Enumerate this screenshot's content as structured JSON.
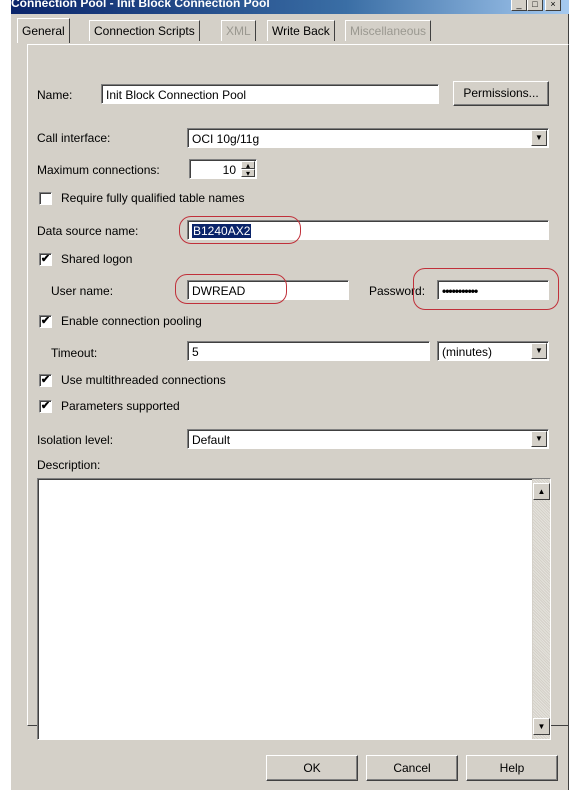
{
  "window": {
    "title": "Connection Pool - Init Block Connection Pool"
  },
  "tabs": [
    {
      "label": "General",
      "state": "active"
    },
    {
      "label": "Connection Scripts",
      "state": "normal"
    },
    {
      "label": "XML",
      "state": "disabled"
    },
    {
      "label": "Write Back",
      "state": "normal"
    },
    {
      "label": "Miscellaneous",
      "state": "disabled"
    }
  ],
  "general": {
    "name_label": "Name:",
    "name_value": "Init Block Connection Pool",
    "permissions_button": "Permissions...",
    "call_interface_label": "Call interface:",
    "call_interface_value": "OCI 10g/11g",
    "max_connections_label": "Maximum connections:",
    "max_connections_value": "10",
    "require_fq_label": "Require fully qualified table names",
    "require_fq_checked": false,
    "data_source_label": "Data source name:",
    "data_source_value": "B1240AX2",
    "shared_logon_label": "Shared logon",
    "shared_logon_checked": true,
    "user_name_label": "User name:",
    "user_name_value": "DWREAD",
    "password_label": "Password:",
    "password_value": "•••••••••••",
    "enable_pooling_label": "Enable connection pooling",
    "enable_pooling_checked": true,
    "timeout_label": "Timeout:",
    "timeout_value": "5",
    "timeout_unit": "(minutes)",
    "multithreaded_label": "Use multithreaded connections",
    "multithreaded_checked": true,
    "parameters_label": "Parameters supported",
    "parameters_checked": true,
    "isolation_label": "Isolation level:",
    "isolation_value": "Default",
    "description_label": "Description:",
    "description_value": ""
  },
  "footer": {
    "ok": "OK",
    "cancel": "Cancel",
    "help": "Help"
  },
  "glyphs": {
    "check": "✔",
    "down_arrow": "▼",
    "up_arrow": "▲",
    "spin_up": "▴",
    "spin_down": "▾",
    "minimize": "_",
    "maximize": "□",
    "close": "×"
  },
  "colors": {
    "annotation": "#c0303a",
    "title_bar": "#0a246a",
    "selection": "#0a246a"
  }
}
